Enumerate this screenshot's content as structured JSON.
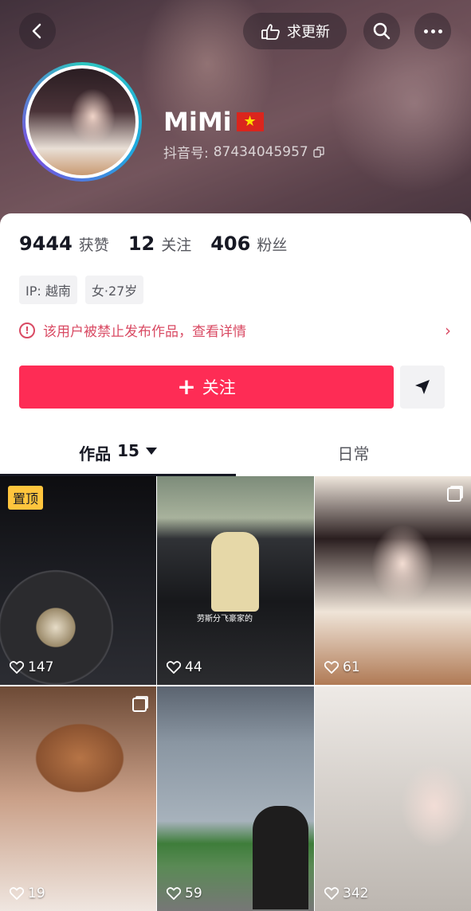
{
  "header": {
    "update_label": "求更新"
  },
  "profile": {
    "name": "MiMi",
    "flag_icon": "vietnam-flag",
    "id_label": "抖音号:",
    "id_value": "87434045957"
  },
  "stats": [
    {
      "value": "9444",
      "label": "获赞"
    },
    {
      "value": "12",
      "label": "关注"
    },
    {
      "value": "406",
      "label": "粉丝"
    }
  ],
  "tags": [
    "IP: 越南",
    "女·27岁"
  ],
  "ban_notice": "该用户被禁止发布作品，查看详情",
  "follow_label": "关注",
  "tabs": {
    "works_label": "作品",
    "works_count": "15",
    "daily_label": "日常"
  },
  "grid": [
    {
      "likes": "147",
      "pinned_label": "置顶"
    },
    {
      "likes": "44",
      "caption": "劳斯分飞豪家的"
    },
    {
      "likes": "61"
    },
    {
      "likes": "19"
    },
    {
      "likes": "59"
    },
    {
      "likes": "342"
    }
  ],
  "colors": {
    "accent": "#fe2c55",
    "ban_text": "#d94a63",
    "pin_badge": "#ffc53d"
  }
}
